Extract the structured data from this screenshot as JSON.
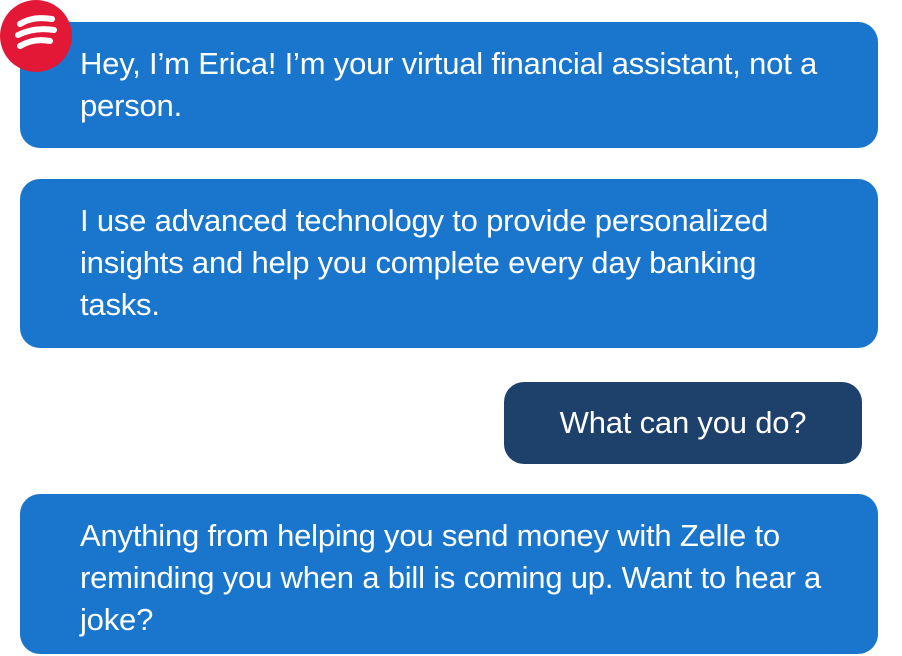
{
  "assistant": {
    "avatar_icon": "erica-logo-icon",
    "avatar_color": "#e31837"
  },
  "messages": [
    {
      "sender": "erica",
      "text": "Hey, I’m Erica! I’m your virtual financial assistant, not a person."
    },
    {
      "sender": "erica",
      "text": "I use advanced technology to provide personalized insights and help you complete every day banking tasks."
    },
    {
      "sender": "user",
      "text": "What can you do?"
    },
    {
      "sender": "erica",
      "text": "Anything from helping you send money with Zelle to reminding you when a bill is coming up. Want to hear a joke?"
    }
  ],
  "colors": {
    "erica_bubble": "#1976cc",
    "user_bubble": "#1d416b",
    "text": "#ffffff",
    "background": "#ffffff"
  }
}
